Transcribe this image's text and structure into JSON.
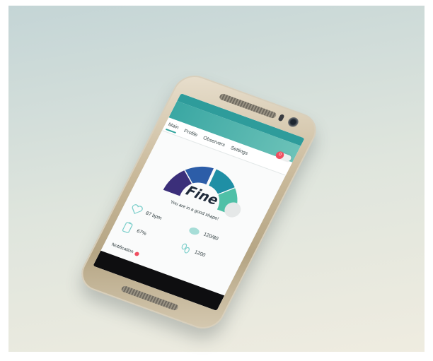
{
  "colors": {
    "accent": "#2ea39c",
    "appbar": "#3aa7a3",
    "notification": "#f04e60",
    "gauge_segments": [
      "#3b2f7a",
      "#2c5da8",
      "#1f8fa5",
      "#4fc0a7"
    ]
  },
  "tabs": [
    {
      "label": "Main"
    },
    {
      "label": "Profile"
    },
    {
      "label": "Observers"
    },
    {
      "label": "Settings"
    }
  ],
  "toggle": {
    "badge": "0"
  },
  "gauge": {
    "status": "Fine"
  },
  "summary": {
    "text": "You are in a good shape!"
  },
  "stats": [
    {
      "icon": "heart-icon",
      "value": "87 bpm"
    },
    {
      "icon": "cloud-icon",
      "value": "120/80"
    },
    {
      "icon": "battery-icon",
      "value": "67%"
    },
    {
      "icon": "footsteps-icon",
      "value": "1200"
    }
  ],
  "notification": {
    "label": "Notification"
  }
}
